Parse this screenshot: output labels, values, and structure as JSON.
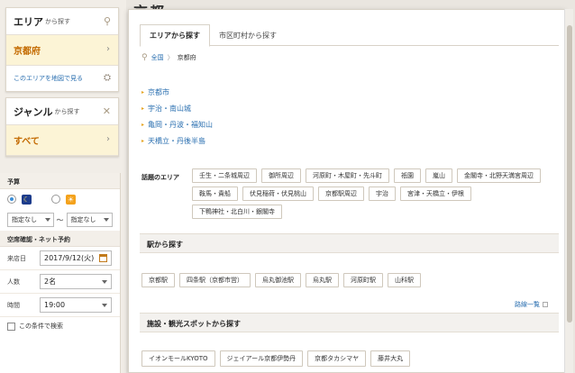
{
  "sidebar": {
    "area": {
      "title": "エリア",
      "sub": "から探す",
      "selected": "京都府",
      "map_link": "このエリアを地図で見る"
    },
    "genre": {
      "title": "ジャンル",
      "sub": "から探す",
      "selected": "すべて"
    }
  },
  "form": {
    "budget_label": "予算",
    "budget_from": "指定なし",
    "budget_sep": "〜",
    "budget_to": "指定なし",
    "availability_label": "空席確認・ネット予約",
    "date_label": "来店日",
    "date_value": "2017/9/12(火)",
    "people_label": "人数",
    "people_value": "2名",
    "time_label": "時間",
    "time_value": "19:00",
    "search_check": "この条件で検索"
  },
  "page": {
    "title": "京都"
  },
  "panel": {
    "tabs": [
      "エリアから探す",
      "市区町村から探す"
    ],
    "breadcrumb": {
      "home": "全国",
      "sep": "〉",
      "current": "京都府"
    },
    "regions": [
      "京都市",
      "宇治・南山城",
      "亀岡・丹波・福知山",
      "天橋立・丹後半島"
    ],
    "popular": {
      "title": "話題のエリア",
      "tags": [
        "壬生・二条城周辺",
        "御所周辺",
        "河原町・木屋町・先斗町",
        "祇園",
        "嵐山",
        "金閣寺・北野天満宮周辺",
        "鞍馬・貴船",
        "伏見稲荷・伏見桃山",
        "京都駅周辺",
        "宇治",
        "宮津・天橋立・伊根",
        "下鴨神社・北白川・銀閣寺"
      ]
    },
    "stations": {
      "title": "駅から探す",
      "items": [
        "京都駅",
        "四条駅（京都市営）",
        "烏丸御池駅",
        "烏丸駅",
        "河原町駅",
        "山科駅"
      ],
      "more": "路線一覧"
    },
    "spots": {
      "title": "施設・観光スポットから探す",
      "items": [
        "イオンモールKYOTO",
        "ジェイアール京都伊勢丹",
        "京都タカシマヤ",
        "藤井大丸"
      ]
    }
  }
}
